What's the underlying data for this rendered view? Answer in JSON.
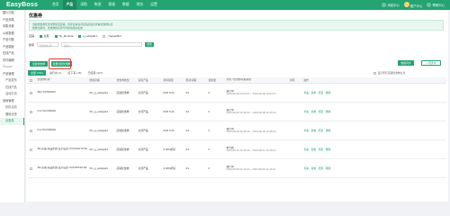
{
  "app": {
    "logo": "EasyBoss"
  },
  "nav": {
    "items": [
      {
        "label": "首页",
        "active": false
      },
      {
        "label": "产品",
        "active": true
      },
      {
        "label": "采购",
        "active": false
      },
      {
        "label": "物流",
        "active": false
      },
      {
        "label": "客服",
        "active": false
      },
      {
        "label": "数据",
        "active": false
      },
      {
        "label": "财务",
        "active": false
      },
      {
        "label": "设置",
        "active": false
      }
    ],
    "right": {
      "notice": "消息中心",
      "account": "账户中心",
      "help": "帮助中心"
    }
  },
  "sidebar": {
    "items": [
      {
        "label": "图片归档",
        "type": "item"
      },
      {
        "label": "产品采集",
        "type": "item"
      },
      {
        "label": "采集设置",
        "type": "item"
      },
      {
        "label": "公用数据",
        "type": "item"
      },
      {
        "label": "产品刊登",
        "type": "item"
      },
      {
        "label": "产品模板",
        "type": "item"
      },
      {
        "label": "在线产品",
        "type": "item"
      },
      {
        "label": "货件编辑",
        "type": "item"
      },
      {
        "label": "Shopee",
        "type": "group"
      },
      {
        "label": "产品管理",
        "type": "item"
      },
      {
        "label": "产品发布",
        "type": "child"
      },
      {
        "label": "在线产品",
        "type": "child"
      },
      {
        "label": "活动引流",
        "type": "child"
      },
      {
        "label": "营销管理",
        "type": "item"
      },
      {
        "label": "折扣活动",
        "type": "child"
      },
      {
        "label": "捆绑优惠",
        "type": "child"
      },
      {
        "label": "优惠券",
        "type": "child",
        "active": true
      }
    ]
  },
  "page": {
    "title": "优惠券",
    "notice_lines": [
      "当前优惠券仅支持添加至店铺，同步后请在对应站点后台查看优惠券信息",
      "批量创建时，优惠券的名称与代码将自动生成"
    ],
    "shop_filter": {
      "label": "店铺",
      "options": [
        {
          "label": "全部",
          "checked": true
        },
        {
          "label": "Tjit_Mnuhtia",
          "checked": true
        },
        {
          "label": "g_ueltwjab4",
          "checked": true
        },
        {
          "label": "_Yaqaw0ftut",
          "checked": false
        }
      ]
    },
    "search": {
      "label": "搜索",
      "field_placeholder": "优惠券名称",
      "keyword_placeholder": "请输入",
      "button": "搜索"
    },
    "buttons": {
      "create": "创建优惠券",
      "batch": "批量创建优惠券",
      "sync": "数据同步",
      "more": "+ 同步中"
    },
    "tabs": [
      {
        "label": "全部 (762)",
        "active": true
      },
      {
        "label": "进行中 (1)",
        "active": false
      },
      {
        "label": "接下来 (16)",
        "active": false
      },
      {
        "label": "已结束 (327)",
        "active": false
      }
    ],
    "tabs_right": "显示所有店铺优惠券信息",
    "table": {
      "headers": [
        "优惠券名称",
        "所属店铺",
        "优惠券类型",
        "适用产品",
        "折扣额度",
        "限领/领取",
        "使用量",
        "状态 / 优惠券领取期限",
        "排序",
        "操作"
      ],
      "rows": [
        {
          "name": "ZEr7JJOWNRM",
          "store": "PH_g_ueltwjab4",
          "scope": "店铺优惠券",
          "products": "全部产品",
          "value": "PHP 5.00",
          "limit": "0/1",
          "used": "0",
          "status": "进行中",
          "period": "2023-08-08 10:04:27 ~ 2023-08-09 10:04:27",
          "sort": "",
          "ops": [
            "查看",
            "复制",
            "结束",
            "删除"
          ]
        },
        {
          "name": "hmr7JUOWMAN",
          "store": "PH_g_ueltwjab4",
          "scope": "店铺优惠券",
          "products": "全部产品",
          "value": "PHP 5.00",
          "limit": "0/1",
          "used": "0",
          "status": "进行中",
          "period": "2023-08-08 16:45:22 ~ 2023-08-09 16:45:22",
          "sort": "",
          "ops": [
            "查看",
            "复制",
            "结束",
            "删除"
          ]
        },
        {
          "name": "hmr7JUOWMAN",
          "store": "PH_g_ueltwjab4",
          "scope": "店铺优惠券",
          "products": "全部产品",
          "value": "PHP 5.00",
          "limit": "0/1",
          "used": "0",
          "status": "进行中",
          "period": "2023-08-08 16:45:22 ~ 2023-08-09 16:45:22",
          "sort": "",
          "ops": [
            "查看",
            "复制",
            "结束",
            "删除"
          ]
        },
        {
          "name": "ZE-店铺-新品优惠-显示设置 COUOGHT3 FE",
          "store": "PH_g_ueltwjab4",
          "scope": "店铺优惠券",
          "products": "全部产品",
          "value": "5.00%折扣",
          "limit": "0/1",
          "used": "0",
          "status": "未开始",
          "period": "2023-08-10 16:45:22 ~ 2023-08-11 16:45:22",
          "sort": "",
          "ops": [
            "查看",
            "复制",
            "结束",
            "删除"
          ]
        },
        {
          "name": "ZE-店铺-新品优惠-显示设置 OUGOPF3A AE",
          "store": "PH_g_ueltwjab4",
          "scope": "店铺优惠券",
          "products": "全部产品",
          "value": "5.00%折扣",
          "limit": "0/1",
          "used": "0",
          "status": "进行中",
          "period": "2023-08-08 11:23:22 ~ 2023-08-09 11:23:22",
          "sort": "",
          "ops": [
            "查看",
            "复制",
            "结束",
            "删除"
          ]
        }
      ]
    }
  }
}
